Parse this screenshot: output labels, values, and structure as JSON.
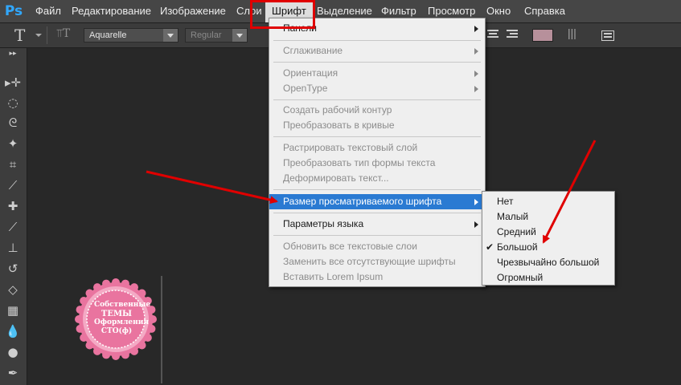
{
  "app": {
    "logo": "Ps"
  },
  "menubar": {
    "items": [
      "Файл",
      "Редактирование",
      "Изображение",
      "Слои",
      "Шрифт",
      "Выделение",
      "Фильтр",
      "Просмотр",
      "Окно",
      "Справка"
    ],
    "active": "Шрифт"
  },
  "options_bar": {
    "tool_icon": "text-tool-icon",
    "font_family": "Aquarelle",
    "font_style": "Regular",
    "text_color": "#b7909b"
  },
  "font_menu": {
    "items": [
      {
        "label": "Панели",
        "disabled": false,
        "submenu": true
      },
      {
        "label": "Сглаживание",
        "disabled": true,
        "submenu": true
      },
      {
        "label": "Ориентация",
        "disabled": true,
        "submenu": true
      },
      {
        "label": "OpenType",
        "disabled": true,
        "submenu": true
      },
      {
        "label": "Создать рабочий контур",
        "disabled": true,
        "submenu": false
      },
      {
        "label": "Преобразовать в кривые",
        "disabled": true,
        "submenu": false
      },
      {
        "label": "Растрировать текстовый слой",
        "disabled": true,
        "submenu": false
      },
      {
        "label": "Преобразовать тип формы текста",
        "disabled": true,
        "submenu": false
      },
      {
        "label": "Деформировать текст...",
        "disabled": true,
        "submenu": false
      },
      {
        "label": "Размер просматриваемого шрифта",
        "disabled": false,
        "submenu": true,
        "highlighted": true
      },
      {
        "label": "Параметры языка",
        "disabled": false,
        "submenu": true
      },
      {
        "label": "Обновить все текстовые слои",
        "disabled": true,
        "submenu": false
      },
      {
        "label": "Заменить все отсутствующие шрифты",
        "disabled": true,
        "submenu": false
      },
      {
        "label": "Вставить Lorem Ipsum",
        "disabled": true,
        "submenu": false
      }
    ]
  },
  "size_submenu": {
    "items": [
      "Нет",
      "Малый",
      "Средний",
      "Большой",
      "Чрезвычайно большой",
      "Огромный"
    ],
    "checked": "Большой",
    "check_mark": "✔"
  },
  "stamp": {
    "text": [
      "Собственные",
      "ТЕМЫ",
      "Оформления",
      "СТО(ф)"
    ]
  },
  "colors": {
    "menubar_bg": "#464646",
    "highlight": "#2a7ad2",
    "annotation_red": "#e00000",
    "stamp_pink": "#e9749f"
  }
}
